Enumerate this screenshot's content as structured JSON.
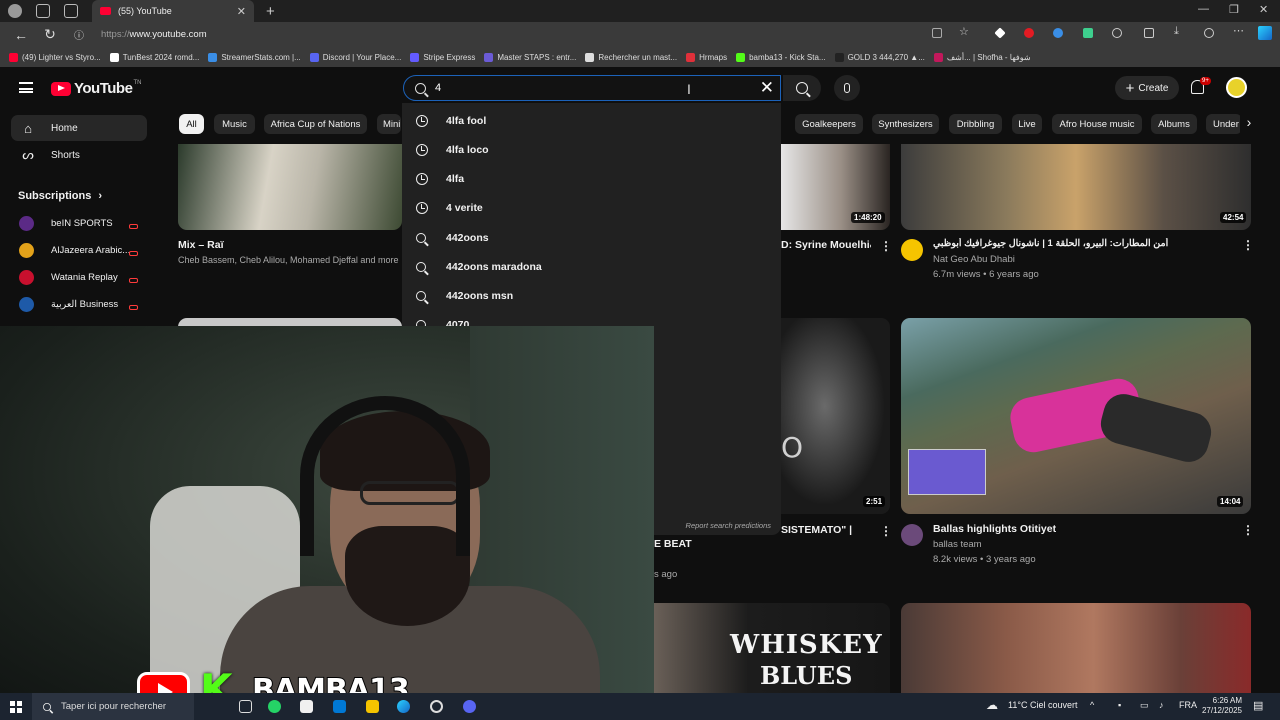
{
  "browser": {
    "tab_title": "(55) YouTube",
    "url_prefix": "https://",
    "url_host": "www.youtube.com"
  },
  "bookmarks": [
    {
      "label": "(49) Lighter vs Styro...",
      "color": "#ff0033"
    },
    {
      "label": "TunBest 2024 romd...",
      "color": "#ffffff"
    },
    {
      "label": "StreamerStats.com |...",
      "color": "#3a8ee6"
    },
    {
      "label": "Discord | Your Place...",
      "color": "#5865f2"
    },
    {
      "label": "Stripe Express",
      "color": "#635bff"
    },
    {
      "label": "Master STAPS : entr...",
      "color": "#6b5bd6"
    },
    {
      "label": "Rechercher un mast...",
      "color": "#dddddd"
    },
    {
      "label": "Hrmaps",
      "color": "#e0303a"
    },
    {
      "label": "bamba13 - Kick Sta...",
      "color": "#53fc18"
    },
    {
      "label": "GOLD 3 444,270 ▲...",
      "color": "#222222"
    },
    {
      "label": "أشف... | Shofha - شوفها",
      "color": "#c2185b"
    }
  ],
  "youtube": {
    "logo_text": "YouTube",
    "logo_sup": "TN",
    "search": {
      "value": "4"
    },
    "create_label": "Create",
    "notif_badge": "9+",
    "sidebar": {
      "home": "Home",
      "shorts": "Shorts",
      "subscriptions": "Subscriptions",
      "channels": [
        {
          "name": "beIN SPORTS",
          "color": "#5b2a86"
        },
        {
          "name": "AlJazeera Arabic...",
          "color": "#e3a21a"
        },
        {
          "name": "Watania Replay",
          "color": "#c8102e"
        },
        {
          "name": "العربية Business",
          "color": "#1e5aa8"
        }
      ]
    },
    "chips": [
      "All",
      "Music",
      "Africa Cup of Nations",
      "Mini",
      "Goalkeepers",
      "Synthesizers",
      "Dribbling",
      "Live",
      "Afro House music",
      "Albums",
      "Under"
    ],
    "suggestions": [
      {
        "text": "4lfa fool",
        "type": "history"
      },
      {
        "text": "4lfa loco",
        "type": "history"
      },
      {
        "text": "4lfa",
        "type": "history"
      },
      {
        "text": "4 verite",
        "type": "history"
      },
      {
        "text": "442oons",
        "type": "search"
      },
      {
        "text": "442oons maradona",
        "type": "search"
      },
      {
        "text": "442oons msn",
        "type": "search"
      },
      {
        "text": "4070",
        "type": "search"
      }
    ],
    "report_label": "Report search predictions",
    "videos": {
      "v1": {
        "title": "Mix – Raï",
        "meta": "Cheb Bassem, Cheb Alilou, Mohamed Djeffal and more"
      },
      "v2": {
        "duration": "1:48:20",
        "title_tail": "D: Syrine Mouelhi&"
      },
      "v3": {
        "duration": "42:54",
        "title": "أمن المطارات: البيرو، الحلقة 1 | ناشونال جيوغرافيك أبوظبي",
        "channel": "Nat Geo Abu Dhabi",
        "meta": "6.7m views • 6 years ago"
      },
      "v4": {
        "duration": "2:51",
        "title_tail": "SISTEMATO\" |",
        "title_tail2": "E BEAT",
        "meta_tail": "s ago"
      },
      "v5": {
        "duration": "14:04",
        "title": "Ballas highlights Otitiyet",
        "channel": "ballas team",
        "meta": "8.2k views • 3 years ago"
      },
      "v6": {
        "thumb_text": "WHISKEY",
        "thumb_text2": "BLUES"
      }
    }
  },
  "overlay": {
    "streamer": "BAMBA13",
    "kick_letter": "K"
  },
  "taskbar": {
    "search_placeholder": "Taper ici pour rechercher",
    "weather": "11°C  Ciel couvert",
    "lang": "FRA",
    "time": "6:26 AM",
    "date": "27/12/2025"
  }
}
